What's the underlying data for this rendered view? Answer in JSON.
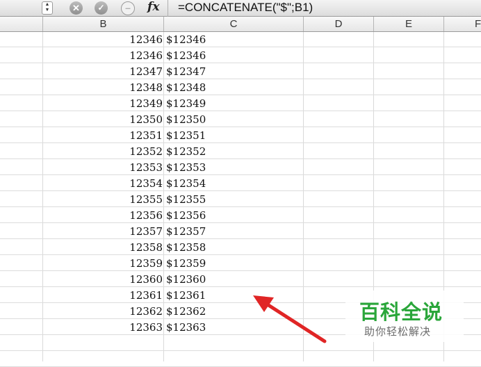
{
  "formula_bar": {
    "fx_label": "fx",
    "formula": "=CONCATENATE(\"$\";B1)"
  },
  "column_headers": [
    "B",
    "C",
    "D",
    "E",
    "F"
  ],
  "rows": [
    {
      "b": "12346",
      "c": "$12346"
    },
    {
      "b": "12346",
      "c": "$12346"
    },
    {
      "b": "12347",
      "c": "$12347"
    },
    {
      "b": "12348",
      "c": "$12348"
    },
    {
      "b": "12349",
      "c": "$12349"
    },
    {
      "b": "12350",
      "c": "$12350"
    },
    {
      "b": "12351",
      "c": "$12351"
    },
    {
      "b": "12352",
      "c": "$12352"
    },
    {
      "b": "12353",
      "c": "$12353"
    },
    {
      "b": "12354",
      "c": "$12354"
    },
    {
      "b": "12355",
      "c": "$12355"
    },
    {
      "b": "12356",
      "c": "$12356"
    },
    {
      "b": "12357",
      "c": "$12357"
    },
    {
      "b": "12358",
      "c": "$12358"
    },
    {
      "b": "12359",
      "c": "$12359"
    },
    {
      "b": "12360",
      "c": "$12360"
    },
    {
      "b": "12361",
      "c": "$12361"
    },
    {
      "b": "12362",
      "c": "$12362"
    },
    {
      "b": "12363",
      "c": "$12363"
    }
  ],
  "watermark": {
    "title": "百科全说",
    "subtitle": "助你轻松解决"
  },
  "colors": {
    "annotation_arrow": "#e02525",
    "watermark_green": "#2aa63a"
  }
}
